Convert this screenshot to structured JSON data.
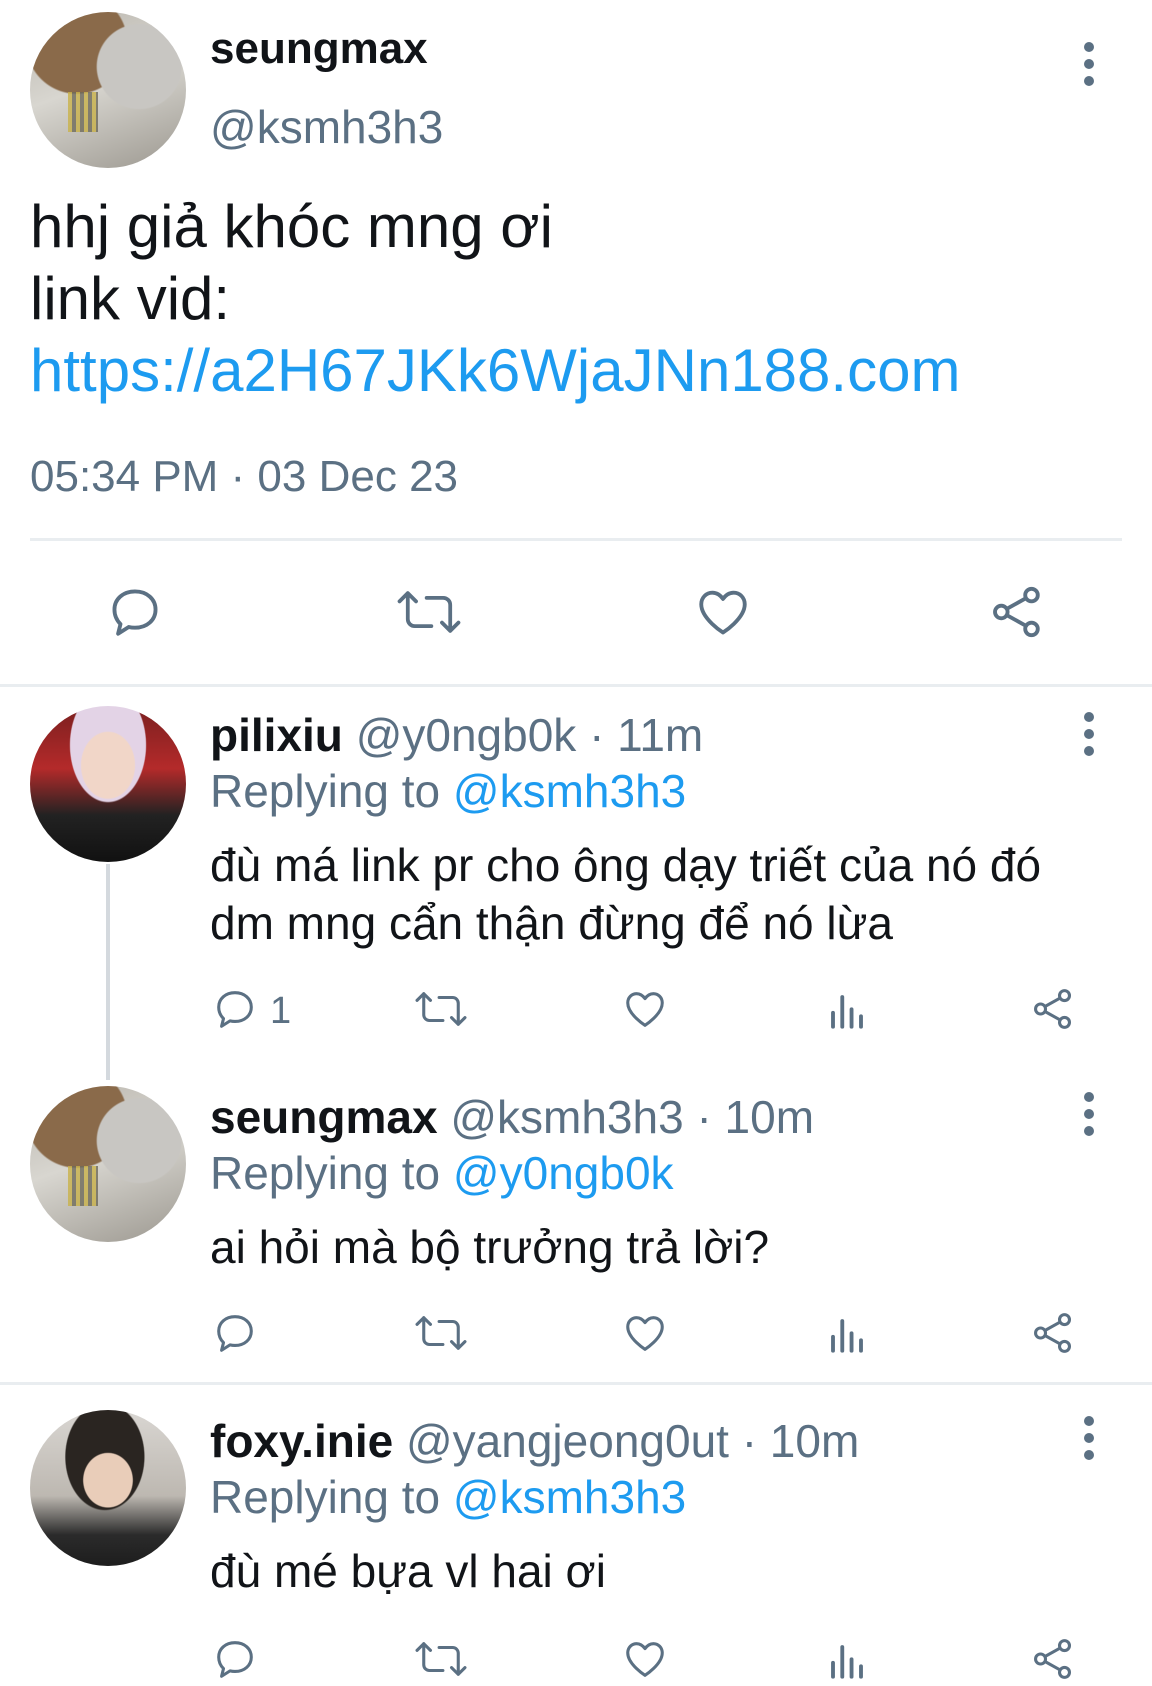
{
  "main_tweet": {
    "display_name": "seungmax",
    "handle": "@ksmh3h3",
    "text_line1": "hhj giả khóc mng ơi",
    "text_line2": "link vid:",
    "link": "https://a2H67JKk6WjaJNn188.com",
    "timestamp": "05:34 PM · 03 Dec 23"
  },
  "replies": [
    {
      "display_name": "pilixiu",
      "handle_time": "@y0ngb0k · 11m",
      "replying_label": "Replying to",
      "replying_to": "@ksmh3h3",
      "text_line1": "đù má link pr cho ông dạy triết của nó đó",
      "text_line2": "dm mng cẩn thận đừng để nó lừa",
      "reply_count": "1"
    },
    {
      "display_name": "seungmax",
      "handle_time": "@ksmh3h3 · 10m",
      "replying_label": "Replying to",
      "replying_to": "@y0ngb0k",
      "text_line1": "ai hỏi mà bộ trưởng trả lời?"
    },
    {
      "display_name": "foxy.inie",
      "handle_time": "@yangjeong0ut · 10m",
      "replying_label": "Replying to",
      "replying_to": "@ksmh3h3",
      "text_line1": "đù mé bựa vl hai ơi"
    }
  ],
  "icons": {
    "reply": "reply-icon",
    "retweet": "retweet-icon",
    "like": "like-icon",
    "views": "views-icon",
    "share": "share-icon",
    "more": "more-options-icon"
  },
  "colors": {
    "link": "#1d9bf0",
    "secondary_text": "#5b7083",
    "icon": "#5b7083",
    "divider": "#e9edf0"
  }
}
